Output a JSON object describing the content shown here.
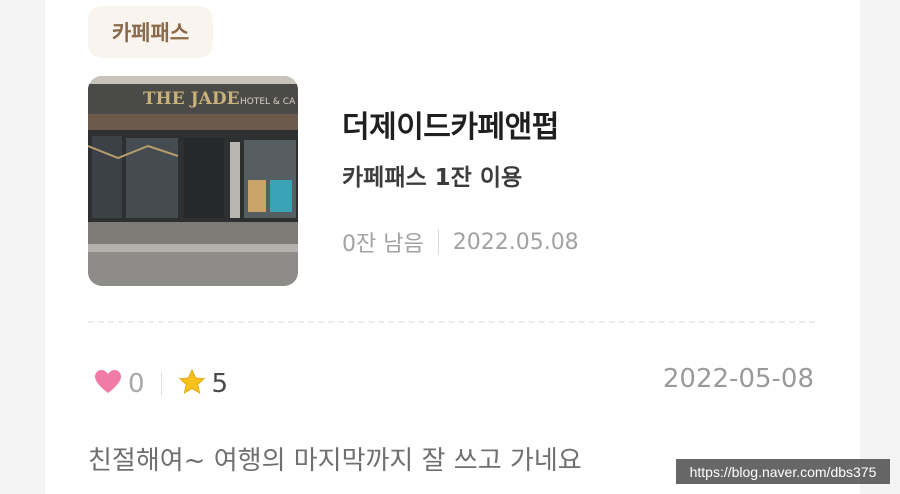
{
  "badge": {
    "label": "카페패스"
  },
  "cafe": {
    "name": "더제이드카페앤펍",
    "usage": "카페패스 1잔 이용",
    "remaining": "0잔 남음",
    "date": "2022.05.08",
    "photo_sign": "THE JADE",
    "photo_sign_sub": "HOTEL & CA"
  },
  "stats": {
    "like_icon": "heart-icon",
    "likes": "0",
    "rating_icon": "star-icon",
    "rating": "5",
    "date": "2022-05-08"
  },
  "review": {
    "text": "친절해여~ 여행의 마지막까지 잘 쓰고 가네요"
  },
  "watermark": {
    "text": "https://blog.naver.com/dbs375"
  },
  "colors": {
    "heart": "#f07ca6",
    "star": "#f7c21b",
    "badge_bg": "#f9f4ee",
    "badge_text": "#8a6a4a"
  }
}
